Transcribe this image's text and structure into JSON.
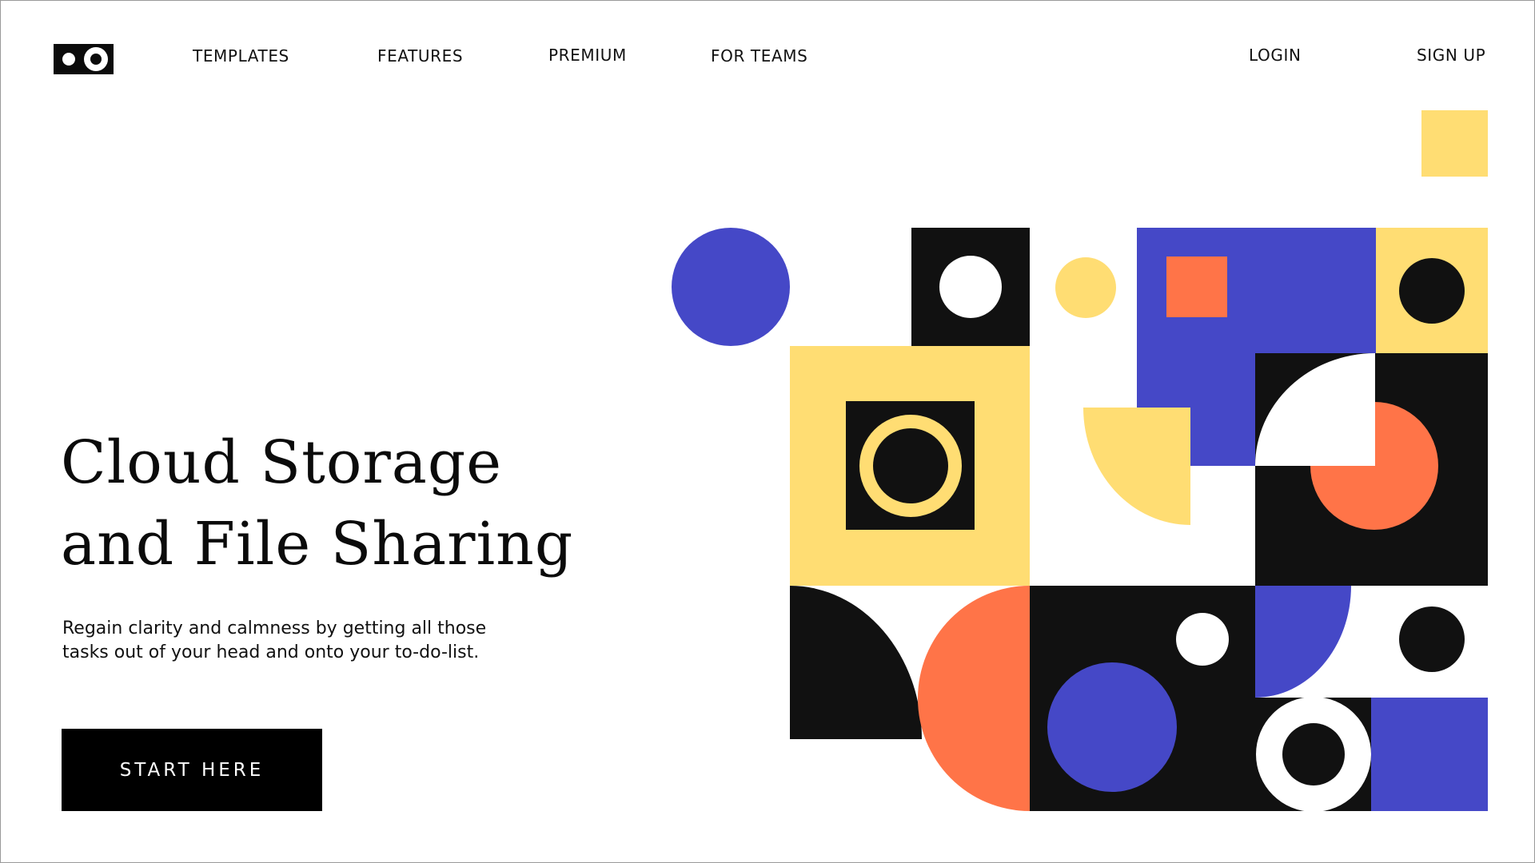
{
  "header": {
    "logo": "logo-icon",
    "nav": [
      {
        "label": "TEMPLATES"
      },
      {
        "label": "FEATURES"
      },
      {
        "label": "PREMIUM"
      },
      {
        "label": "FOR TEAMS"
      }
    ],
    "login_label": "LOGIN",
    "signup_label": "SIGN UP"
  },
  "hero": {
    "title_line1": "Cloud Storage",
    "title_line2": "and File Sharing",
    "subtitle_line1": "Regain clarity and calmness by getting all those",
    "subtitle_line2": "tasks out of your head and onto your to-do-list.",
    "cta_label": "START HERE"
  },
  "palette": {
    "black": "#111111",
    "blue": "#4548c7",
    "yellow": "#ffdd73",
    "orange": "#ff7448",
    "white": "#ffffff"
  }
}
